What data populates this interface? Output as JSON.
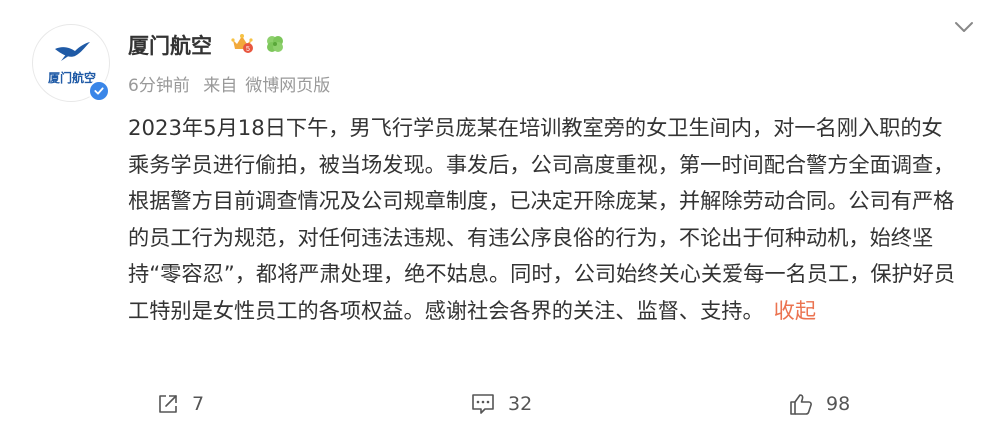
{
  "post": {
    "author": "厦门航空",
    "avatar_text": "厦门航空",
    "time": "6分钟前",
    "source_prefix": "来自",
    "source": "微博网页版",
    "body_text": "2023年5月18日下午，男飞行学员庞某在培训教室旁的女卫生间内，对一名刚入职的女乘务学员进行偷拍，被当场发现。事发后，公司高度重视，第一时间配合警方全面调查，根据警方目前调查情况及公司规章制度，已决定开除庞某，并解除劳动合同。公司有严格的员工行为规范，对任何违法违规、有违公序良俗的行为，不论出于何种动机，始终坚持“零容忍”，都将严肃处理，绝不姑息。同时，公司始终关心关爱每一名员工，保护好员工特别是女性员工的各项权益。感谢社会各界的关注、监督、支持。",
    "collapse_label": "收起"
  },
  "actions": {
    "share_count": "7",
    "comment_count": "32",
    "like_count": "98"
  },
  "icons": {
    "avatar_logo": "swallow-logo-icon",
    "verified": "verified-badge-icon",
    "crown": "crown-badge-icon",
    "clover": "clover-badge-icon",
    "menu": "chevron-down-icon",
    "share": "share-icon",
    "comment": "comment-icon",
    "like": "thumbs-up-icon"
  },
  "colors": {
    "brand_blue": "#1f5aa6",
    "link_orange": "#eb7350",
    "meta_gray": "#999999"
  }
}
